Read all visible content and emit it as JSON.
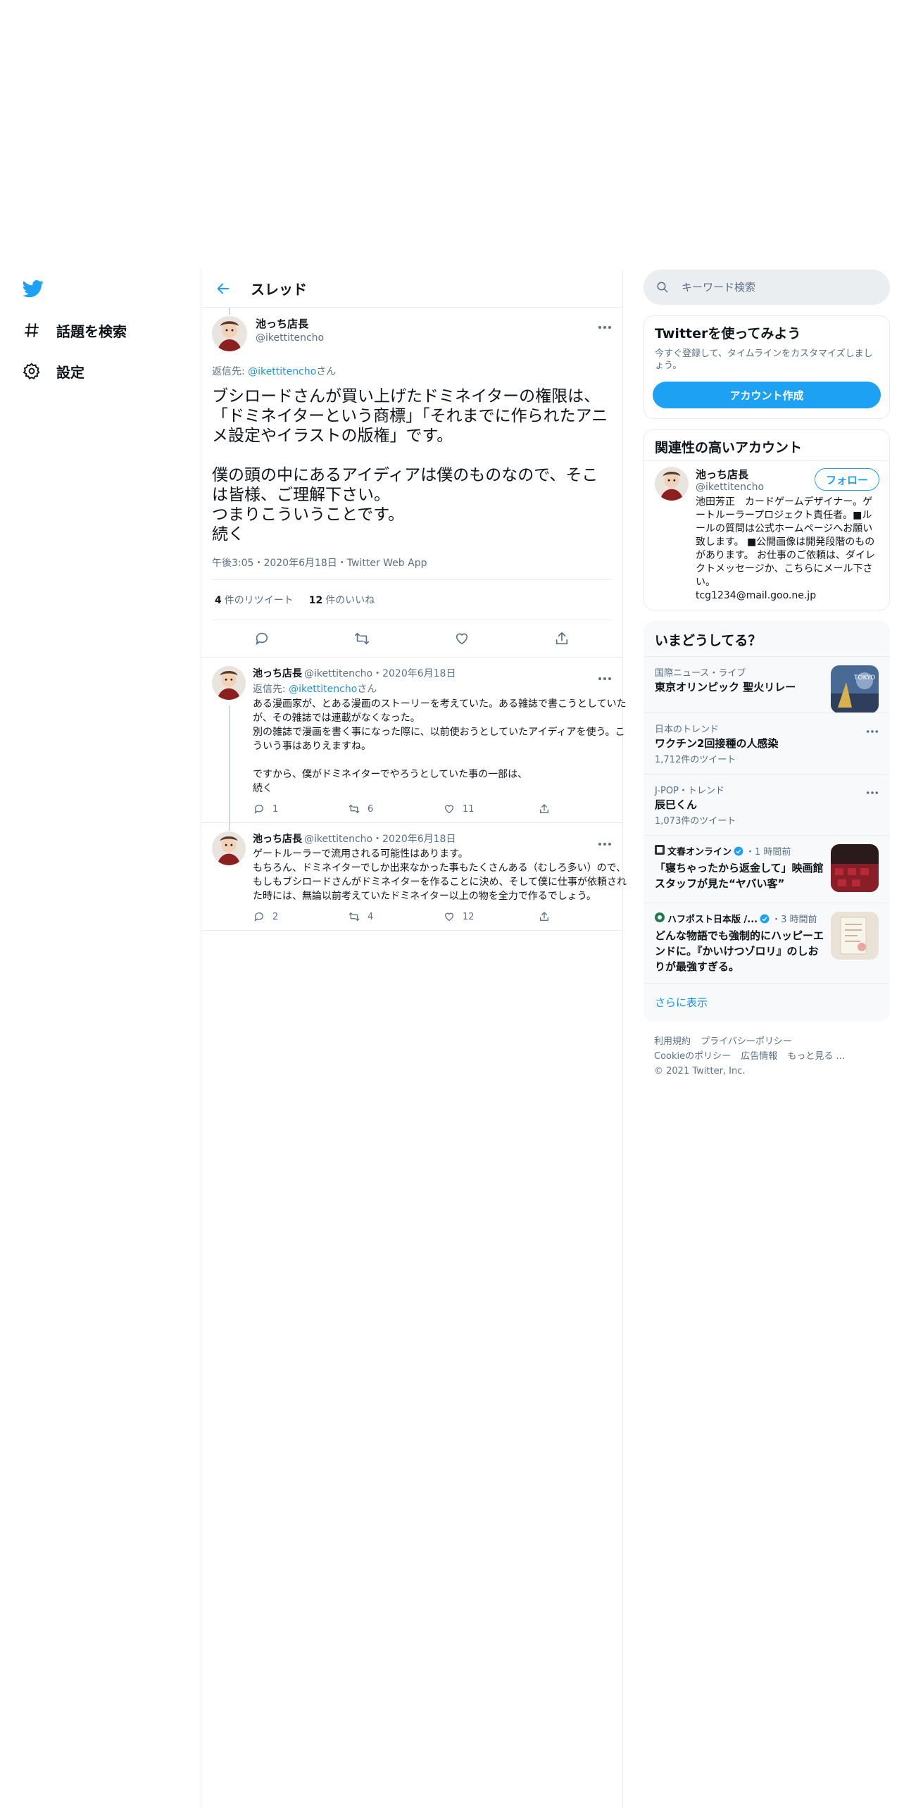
{
  "nav": {
    "items": [
      {
        "label": "話題を検索",
        "icon": "hash-icon"
      },
      {
        "label": "設定",
        "icon": "gear-icon"
      }
    ]
  },
  "header": {
    "title": "スレッド"
  },
  "focus": {
    "name": "池っち店長",
    "handle": "@ikettitencho",
    "reply_prefix": "返信先: ",
    "reply_handle": "@ikettitencho",
    "reply_suffix": "さん",
    "text": "ブシロードさんが買い上げたドミネイターの権限は、「ドミネイターという商標」「それまでに作られたアニメ設定やイラストの版権」です。\n\n僕の頭の中にあるアイディアは僕のものなので、そこは皆様、ご理解下さい。\nつまりこういうことです。\n続く",
    "meta": "午後3:05・2020年6月18日・Twitter Web App",
    "retweets_num": "4",
    "retweets_label": "件のリツイート",
    "likes_num": "12",
    "likes_label": "件のいいね"
  },
  "replies": [
    {
      "name": "池っち店長",
      "handle": "@ikettitencho",
      "date": "・2020年6月18日",
      "reply_prefix": "返信先: ",
      "reply_handle": "@ikettitencho",
      "reply_suffix": "さん",
      "text": "ある漫画家が、とある漫画のストーリーを考えていた。ある雑誌で書こうとしていたが、その雑誌では連載がなくなった。\n別の雑誌で漫画を書く事になった際に、以前使おうとしていたアイディアを使う。こういう事はありえますね。\n\nですから、僕がドミネイターでやろうとしていた事の一部は、\n続く",
      "replies": "1",
      "retweets": "6",
      "likes": "11"
    },
    {
      "name": "池っち店長",
      "handle": "@ikettitencho",
      "date": "・2020年6月18日",
      "text": "ゲートルーラーで流用される可能性はあります。\nもちろん、ドミネイターでしか出来なかった事もたくさんある（むしろ多い）ので、もしもブシロードさんがドミネイターを作ることに決め、そして僕に仕事が依頼された時には、無論以前考えていたドミネイター以上の物を全力で作るでしょう。",
      "replies": "2",
      "retweets": "4",
      "likes": "12"
    }
  ],
  "search": {
    "placeholder": "キーワード検索"
  },
  "signup": {
    "title": "Twitterを使ってみよう",
    "desc": "今すぐ登録して、タイムラインをカスタマイズしましょう。",
    "button": "アカウント作成"
  },
  "related": {
    "title": "関連性の高いアカウント",
    "name": "池っち店長",
    "handle": "@ikettitencho",
    "follow": "フォロー",
    "bio": "池田芳正　カードゲームデザイナー。ゲートルーラープロジェクト責任者。■ルールの質問は公式ホームページへお願い致します。 ■公開画像は開発段階のものがあります。 お仕事のご依頼は、ダイレクトメッセージか、こちらにメール下さい。\ntcg1234@mail.goo.ne.jp"
  },
  "trends": {
    "title": "いまどうしてる？",
    "items": [
      {
        "meta": "国際ニュース・ライブ",
        "title": "東京オリンピック 聖火リレー",
        "count": "",
        "thumb_label": "TOKYO"
      },
      {
        "meta": "日本のトレンド",
        "title": "ワクチン2回接種の人感染",
        "count": "1,712件のツイート"
      },
      {
        "meta": "J-POP・トレンド",
        "title": "辰巳くん",
        "count": "1,073件のツイート"
      }
    ],
    "news": [
      {
        "source": "文春オンライン",
        "time": "・1 時間前",
        "title": "「寝ちゃったから返金して」映画館スタッフが見た“ヤバい客”"
      },
      {
        "source": "ハフポスト日本版 /...",
        "time": "・3 時間前",
        "title": "どんな物語でも強制的にハッピーエンドに。『かいけつゾロリ』のしおりが最強すぎる。"
      }
    ],
    "show_more": "さらに表示"
  },
  "footer": {
    "links": [
      "利用規約",
      "プライバシーポリシー",
      "Cookieのポリシー",
      "広告情報",
      "もっと見る ..."
    ],
    "copyright": "© 2021 Twitter, Inc."
  },
  "colors": {
    "accent": "#1da1f2",
    "link": "#1b95e0",
    "secondary": "#5b7083",
    "border": "#e6ecf0"
  }
}
